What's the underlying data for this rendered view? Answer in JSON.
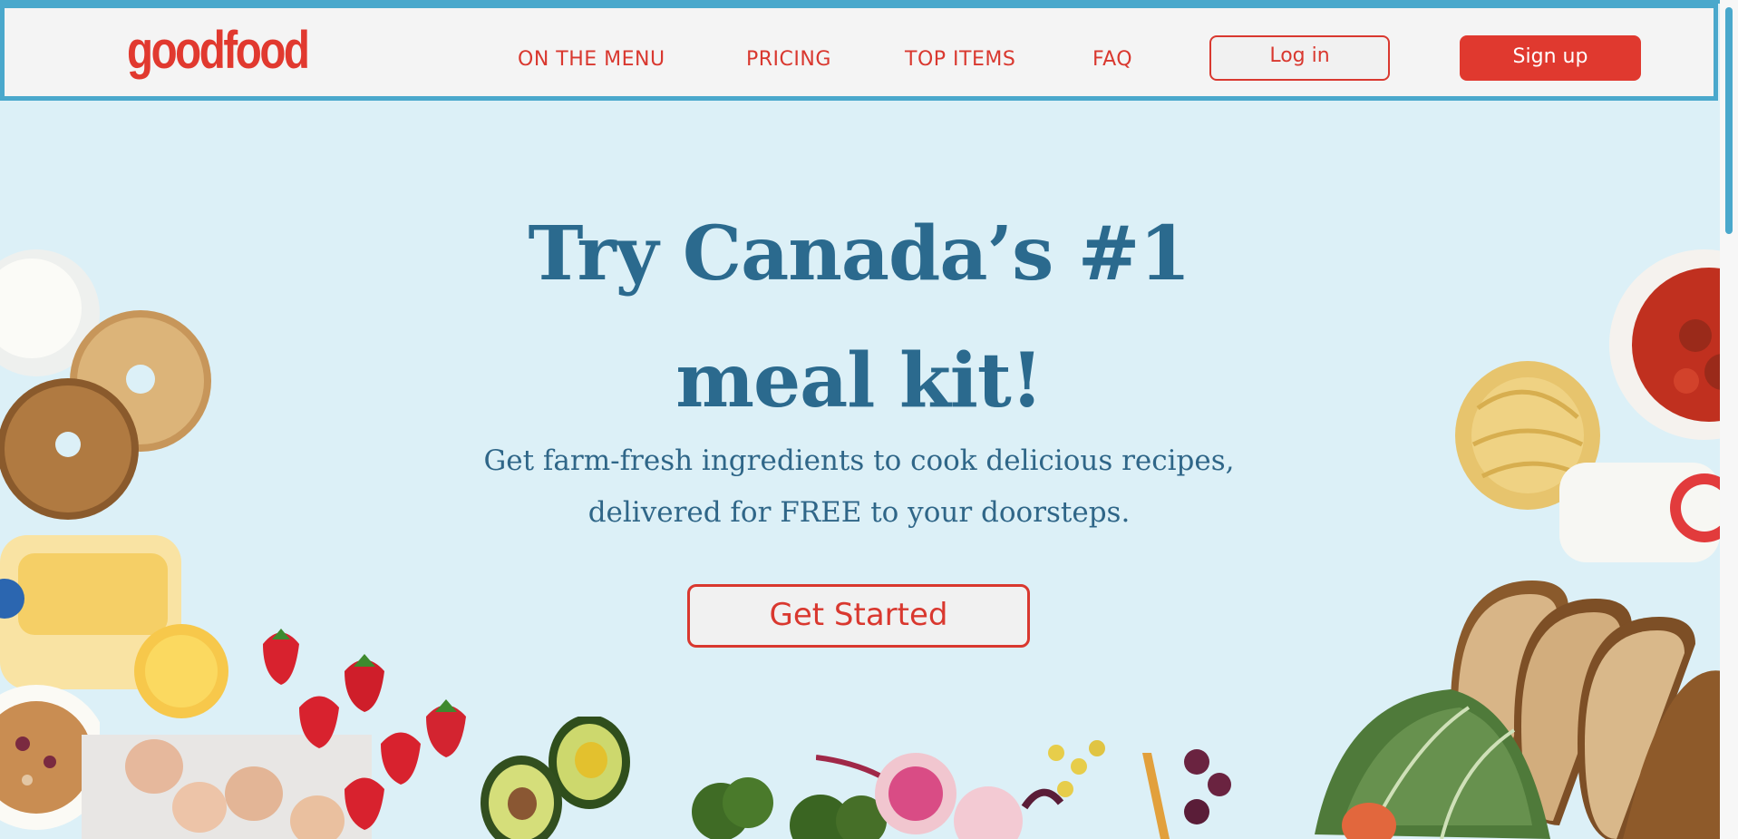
{
  "brand": {
    "logo": "goodfood",
    "accent": "#e0392f",
    "primary_text": "#2b6a8e",
    "background": "#dcf0f7",
    "nav_border": "#4aa8cc"
  },
  "nav": {
    "links": [
      {
        "label": "ON THE MENU"
      },
      {
        "label": "PRICING"
      },
      {
        "label": "TOP ITEMS"
      },
      {
        "label": "FAQ"
      }
    ],
    "login_label": "Log in",
    "signup_label": "Sign up"
  },
  "hero": {
    "title": "Try Canada’s #1 meal kit!",
    "subtitle": "Get farm-fresh ingredients to cook delicious recipes, delivered for FREE to your doorsteps.",
    "cta_label": "Get Started"
  }
}
